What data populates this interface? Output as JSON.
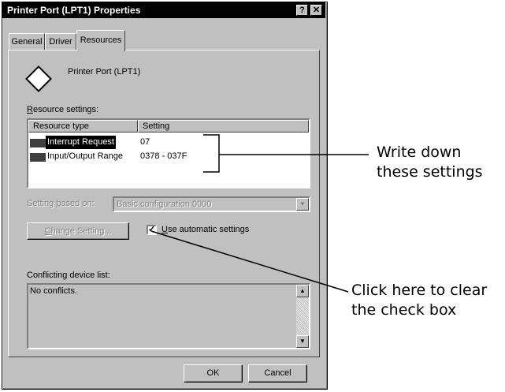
{
  "window": {
    "title": "Printer Port (LPT1) Properties",
    "help_button": "?",
    "close_button": "✕"
  },
  "tabs": [
    {
      "label": "General"
    },
    {
      "label": "Driver"
    },
    {
      "label": "Resources"
    }
  ],
  "device": {
    "name": "Printer Port (LPT1)"
  },
  "resource_settings": {
    "label_prefix": "R",
    "label_rest": "esource settings:",
    "columns": [
      "Resource type",
      "Setting"
    ],
    "rows": [
      {
        "type": "Interrupt Request",
        "setting": "07",
        "selected": true
      },
      {
        "type": "Input/Output Range",
        "setting": "0378 - 037F",
        "selected": false
      }
    ]
  },
  "setting_based_on": {
    "label_a": "Setting ",
    "label_u": "b",
    "label_b": "ased on:",
    "value": "Basic configuration 0000"
  },
  "change_setting_button": {
    "label_u": "C",
    "label_rest": "hange Setting..."
  },
  "use_automatic": {
    "check_mark": "✓",
    "label_u": "U",
    "label_rest": "se automatic settings",
    "checked": true
  },
  "conflicts": {
    "label": "Conflicting device list:",
    "text": "No conflicts."
  },
  "buttons": {
    "ok": "OK",
    "cancel": "Cancel"
  },
  "annotations": {
    "settings_line1": "Write down",
    "settings_line2": "these settings",
    "checkbox_line1": "Click here to clear",
    "checkbox_line2": "the check box"
  }
}
